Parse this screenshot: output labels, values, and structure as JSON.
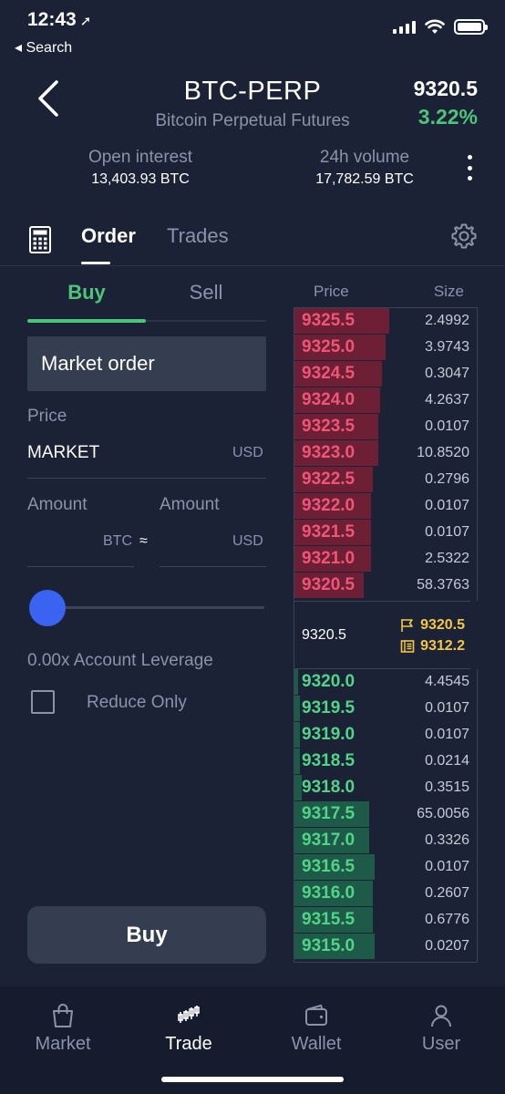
{
  "status_bar": {
    "time": "12:43",
    "back_label": "◂ Search",
    "icons": [
      "location-arrow-icon",
      "cellular-signal-icon",
      "wifi-icon",
      "battery-icon"
    ]
  },
  "header": {
    "title": "BTC-PERP",
    "subtitle": "Bitcoin Perpetual Futures",
    "last_price": "9320.5",
    "change": "3.22%",
    "open_interest_label": "Open interest",
    "open_interest_value": "13,403.93 BTC",
    "volume_label": "24h volume",
    "volume_value": "17,782.59 BTC"
  },
  "tabs": {
    "order": "Order",
    "trades": "Trades",
    "active": "Order"
  },
  "order_form": {
    "buy_label": "Buy",
    "sell_label": "Sell",
    "active_side": "Buy",
    "order_type": "Market order",
    "price_label": "Price",
    "price_value": "MARKET",
    "price_unit": "USD",
    "amount_label_1": "Amount",
    "amount_label_2": "Amount",
    "amount_unit_1": "BTC",
    "approx": "≈",
    "amount_unit_2": "USD",
    "slider_fraction": 0,
    "leverage_text": "0.00x Account Leverage",
    "reduce_only_label": "Reduce Only",
    "reduce_only_checked": false,
    "submit_label": "Buy"
  },
  "orderbook": {
    "price_header": "Price",
    "size_header": "Size",
    "asks": [
      {
        "price": "9325.5",
        "size": "2.4992",
        "depth": 0.52
      },
      {
        "price": "9325.0",
        "size": "3.9743",
        "depth": 0.5
      },
      {
        "price": "9324.5",
        "size": "0.3047",
        "depth": 0.48
      },
      {
        "price": "9324.0",
        "size": "4.2637",
        "depth": 0.47
      },
      {
        "price": "9323.5",
        "size": "0.0107",
        "depth": 0.46
      },
      {
        "price": "9323.0",
        "size": "10.8520",
        "depth": 0.46
      },
      {
        "price": "9322.5",
        "size": "0.2796",
        "depth": 0.43
      },
      {
        "price": "9322.0",
        "size": "0.0107",
        "depth": 0.42
      },
      {
        "price": "9321.5",
        "size": "0.0107",
        "depth": 0.42
      },
      {
        "price": "9321.0",
        "size": "2.5322",
        "depth": 0.42
      },
      {
        "price": "9320.5",
        "size": "58.3763",
        "depth": 0.38
      }
    ],
    "mid_price": "9320.5",
    "mark_price": "9320.5",
    "index_price": "9312.2",
    "bids": [
      {
        "price": "9320.0",
        "size": "4.4545",
        "depth": 0.02
      },
      {
        "price": "9319.5",
        "size": "0.0107",
        "depth": 0.03
      },
      {
        "price": "9319.0",
        "size": "0.0107",
        "depth": 0.03
      },
      {
        "price": "9318.5",
        "size": "0.0214",
        "depth": 0.03
      },
      {
        "price": "9318.0",
        "size": "0.3515",
        "depth": 0.04
      },
      {
        "price": "9317.5",
        "size": "65.0056",
        "depth": 0.41
      },
      {
        "price": "9317.0",
        "size": "0.3326",
        "depth": 0.41
      },
      {
        "price": "9316.5",
        "size": "0.0107",
        "depth": 0.44
      },
      {
        "price": "9316.0",
        "size": "0.2607",
        "depth": 0.43
      },
      {
        "price": "9315.5",
        "size": "0.6776",
        "depth": 0.43
      },
      {
        "price": "9315.0",
        "size": "0.0207",
        "depth": 0.44
      }
    ]
  },
  "colors": {
    "background": "#1b2236",
    "green": "#4cc47a",
    "red": "#ef5576",
    "blue": "#3a63f2",
    "yellow": "#f3c644"
  },
  "bottom_nav": {
    "market": "Market",
    "trade": "Trade",
    "wallet": "Wallet",
    "user": "User",
    "active": "Trade"
  }
}
